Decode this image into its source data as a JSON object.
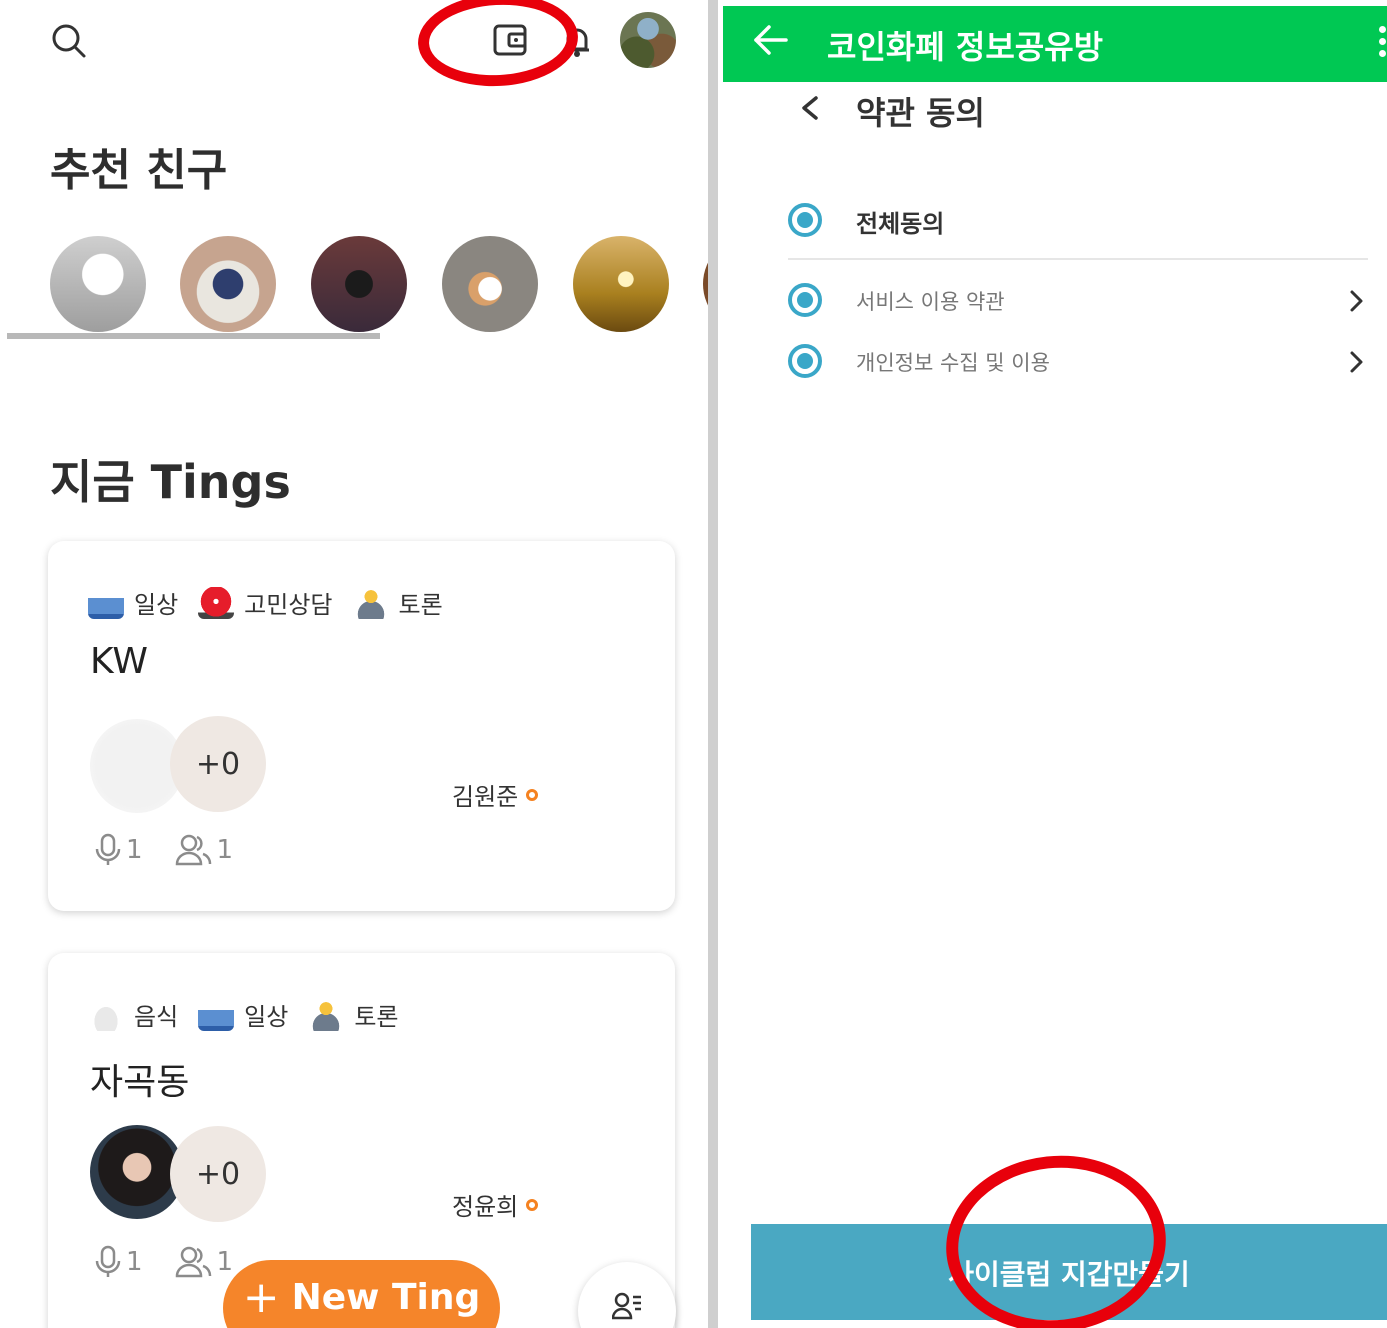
{
  "left_panel": {
    "friends_title": "추천 친구",
    "tings_title": "지금 Tings",
    "cards": [
      {
        "tags": [
          {
            "icon": "sofa-icon",
            "label": "일상"
          },
          {
            "icon": "siren-icon",
            "label": "고민상담"
          },
          {
            "icon": "raising-hand-person-icon",
            "label": "토론"
          }
        ],
        "title": "KW",
        "plus_count": "+0",
        "host_name": "김원준",
        "mic_count": "1",
        "listener_count": "1"
      },
      {
        "tags": [
          {
            "icon": "noodle-bowl-icon",
            "label": "음식"
          },
          {
            "icon": "sofa-icon",
            "label": "일상"
          },
          {
            "icon": "raising-hand-person-icon",
            "label": "토론"
          }
        ],
        "title": "자곡동",
        "plus_count": "+0",
        "host_name": "정윤희",
        "mic_count": "1",
        "listener_count": "1"
      }
    ],
    "new_ting_label": "New Ting",
    "colors": {
      "accent": "#f5852a",
      "annotation": "#e8000b"
    }
  },
  "right_panel": {
    "chat_title": "코인화페 정보공유방",
    "terms_title": "약관 동의",
    "agree_all": "전체동의",
    "items": [
      {
        "label": "서비스 이용 약관"
      },
      {
        "label": "개인정보 수집 및 이용"
      }
    ],
    "create_wallet_label": "사이클럽 지갑만들기",
    "colors": {
      "header": "#00c853",
      "radio": "#3aa7c8",
      "button": "#4aa8c2"
    }
  }
}
